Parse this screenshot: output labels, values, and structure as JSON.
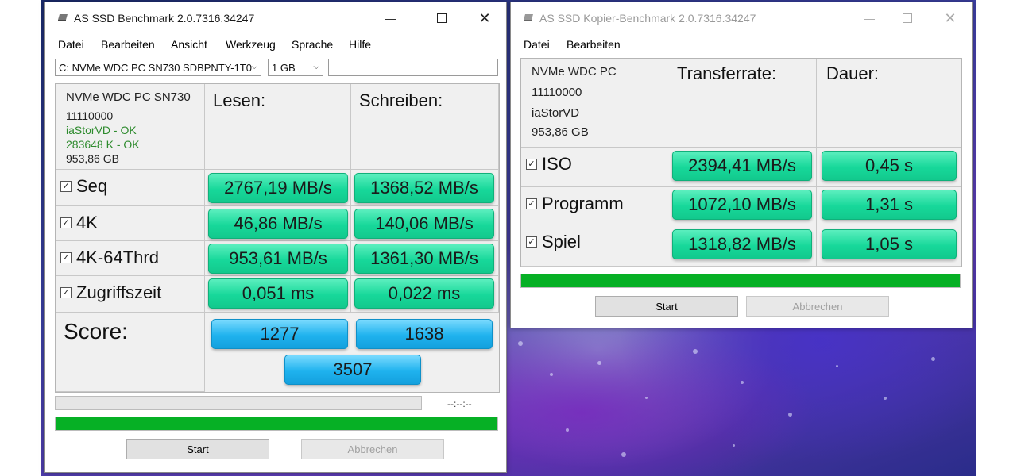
{
  "window1": {
    "title": "AS SSD Benchmark 2.0.7316.34247",
    "menu": [
      "Datei",
      "Bearbeiten",
      "Ansicht",
      "Werkzeug",
      "Sprache",
      "Hilfe"
    ],
    "drive_select": "C: NVMe WDC PC SN730 SDBPNTY-1T0",
    "size_select": "1 GB",
    "info": {
      "model": "NVMe WDC PC SN730",
      "firmware": "11110000",
      "driver": "iaStorVD - OK",
      "alignment": "283648 K - OK",
      "capacity": "953,86 GB"
    },
    "col_read": "Lesen:",
    "col_write": "Schreiben:",
    "rows": [
      {
        "label": "Seq",
        "read": "2767,19 MB/s",
        "write": "1368,52 MB/s"
      },
      {
        "label": "4K",
        "read": "46,86 MB/s",
        "write": "140,06 MB/s"
      },
      {
        "label": "4K-64Thrd",
        "read": "953,61 MB/s",
        "write": "1361,30 MB/s"
      },
      {
        "label": "Zugriffszeit",
        "read": "0,051 ms",
        "write": "0,022 ms"
      }
    ],
    "score_label": "Score:",
    "score_read": "1277",
    "score_write": "1638",
    "score_total": "3507",
    "time_text": "--:--:--",
    "progress_top": 0,
    "progress_bottom": 1.0,
    "start_label": "Start",
    "cancel_label": "Abbrechen"
  },
  "window2": {
    "title": "AS SSD Kopier-Benchmark 2.0.7316.34247",
    "menu": [
      "Datei",
      "Bearbeiten"
    ],
    "info": {
      "model": "NVMe WDC PC",
      "firmware": "11110000",
      "driver": "iaStorVD",
      "capacity": "953,86 GB"
    },
    "col_rate": "Transferrate:",
    "col_time": "Dauer:",
    "rows": [
      {
        "label": "ISO",
        "rate": "2394,41 MB/s",
        "time": "0,45 s"
      },
      {
        "label": "Programm",
        "rate": "1072,10 MB/s",
        "time": "1,31 s"
      },
      {
        "label": "Spiel",
        "rate": "1318,82 MB/s",
        "time": "1,05 s"
      }
    ],
    "progress": 1.0,
    "start_label": "Start",
    "cancel_label": "Abbrechen"
  },
  "colors": {
    "result_green": "#17d89a",
    "score_blue": "#1fb2ee",
    "progress_green": "#06b025"
  }
}
